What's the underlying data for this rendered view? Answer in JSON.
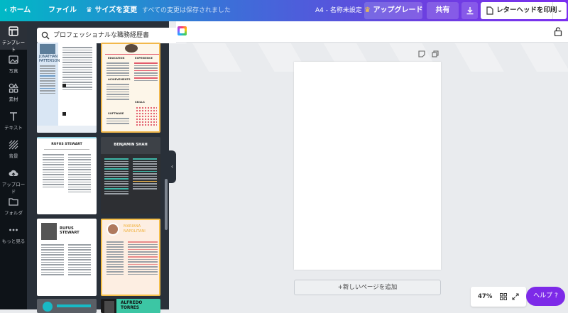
{
  "topbar": {
    "home": "ホーム",
    "file": "ファイル",
    "resize": "サイズを変更",
    "save_status": "すべての変更は保存されました",
    "doc_title": "A4 - 名称未設定",
    "upgrade": "アップグレード",
    "share": "共有",
    "print": "レターヘッドを印刷"
  },
  "sidebar": {
    "items": [
      {
        "label": "テンプレート",
        "icon": "template-icon"
      },
      {
        "label": "写真",
        "icon": "photo-icon"
      },
      {
        "label": "素材",
        "icon": "elements-icon"
      },
      {
        "label": "テキスト",
        "icon": "text-icon"
      },
      {
        "label": "背景",
        "icon": "background-icon"
      },
      {
        "label": "アップロード",
        "icon": "upload-icon"
      },
      {
        "label": "フォルダ",
        "icon": "folder-icon"
      },
      {
        "label": "もっと見る",
        "icon": "more-icon"
      }
    ]
  },
  "search": {
    "value": "プロフェッショナルな職務経歴書"
  },
  "templates": [
    {
      "name": "JONATHAN PATTERSON"
    },
    {
      "name": "",
      "sections": [
        "EDUCATION",
        "EXPERIENCE",
        "ACHIEVEMENTS",
        "SKILLS",
        "SOFTWARE"
      ]
    },
    {
      "name": "RUFUS STEWART"
    },
    {
      "name": "BENJAMIN SHAH"
    },
    {
      "name": "RUFUS STEWART"
    },
    {
      "name": "MARIANA NAPOLITANI"
    },
    {
      "name": ""
    },
    {
      "name": "ALFREDO TORRES"
    }
  ],
  "canvas": {
    "add_page": "+新しいページを追加"
  },
  "zoom": {
    "level": "47%"
  },
  "help": {
    "label": "ヘルプ ?"
  },
  "colors": {
    "accent": "#7d2ae8",
    "panel": "#293039",
    "sidebar": "#0e1318"
  }
}
